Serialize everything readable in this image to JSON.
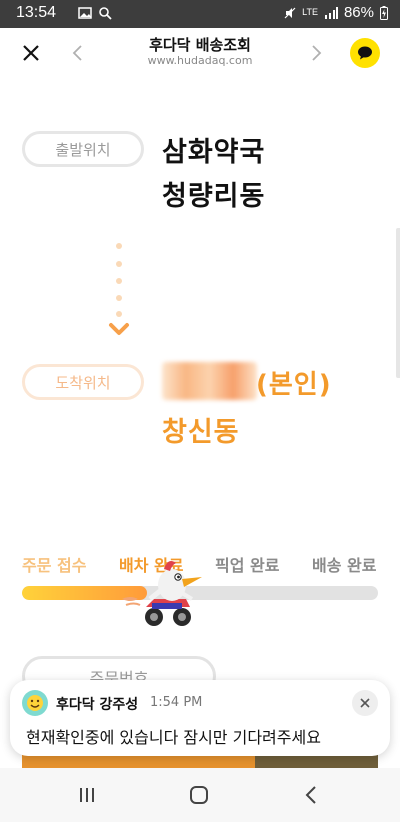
{
  "status_bar": {
    "time": "13:54",
    "network": "LTE",
    "battery": "86%"
  },
  "header": {
    "title": "후다닥 배송조회",
    "url": "www.hudadaq.com"
  },
  "origin": {
    "label": "출발위치",
    "name": "삼화약국",
    "area": "청량리동"
  },
  "destination": {
    "label": "도착위치",
    "name_suffix": "(본인)",
    "area": "창신동"
  },
  "steps": [
    {
      "label": "주문 접수",
      "state": "done"
    },
    {
      "label": "배차 완료",
      "state": "current"
    },
    {
      "label": "픽업 완료",
      "state": "pending"
    },
    {
      "label": "배송 완료",
      "state": "pending"
    }
  ],
  "progress": {
    "fraction": 0.35
  },
  "order_button": {
    "label": "주문번호"
  },
  "notification": {
    "sender": "후다닥 강주성",
    "time": "1:54 PM",
    "message": "현재확인중에 있습니다 잠시만 기다려주세요"
  },
  "colors": {
    "accent": "#f39a2b",
    "step_done": "#f7c27e",
    "step_pending": "#8a8a8a",
    "kakao": "#ffe100"
  }
}
